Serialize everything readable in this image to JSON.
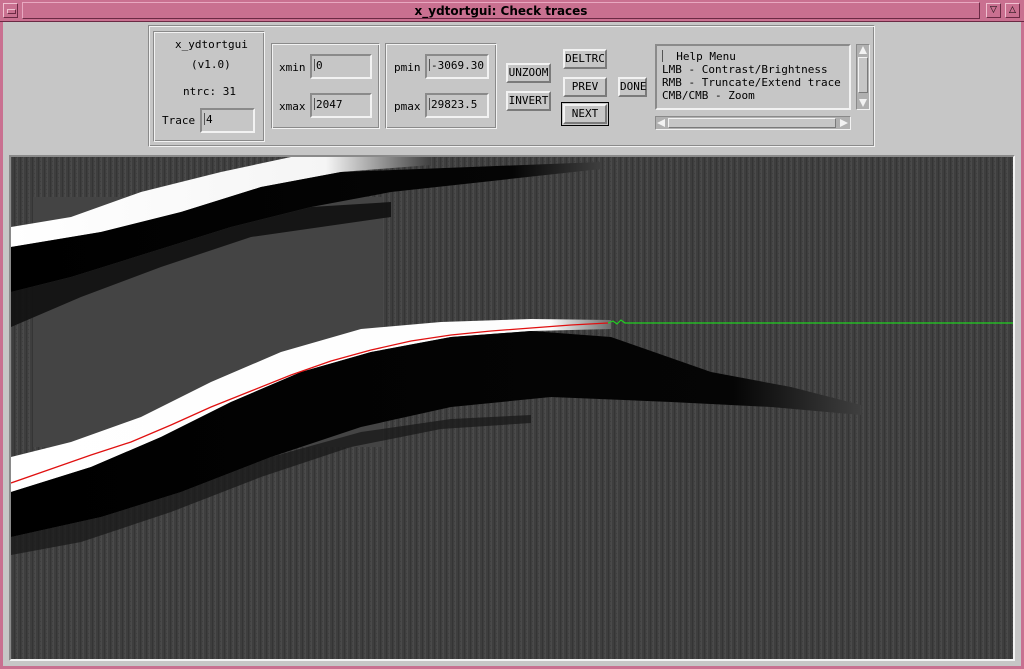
{
  "window": {
    "title": "x_ydtortgui: Check traces"
  },
  "info": {
    "app_name": "x_ydtortgui",
    "version": "(v1.0)",
    "ntrc_text": "ntrc: 31",
    "trace_label": "Trace",
    "trace_value": "4"
  },
  "xrange": {
    "xmin_label": "xmin",
    "xmin_value": "0",
    "xmax_label": "xmax",
    "xmax_value": "2047"
  },
  "prange": {
    "pmin_label": "pmin",
    "pmin_value": "-3069.30",
    "pmax_label": "pmax",
    "pmax_value": "29823.5"
  },
  "buttons": {
    "unzoom": "UNZOOM",
    "invert": "INVERT",
    "deltrc": "DELTRC",
    "prev": "PREV",
    "next": "NEXT",
    "done": "DONE"
  },
  "help": {
    "lines": [
      "Help Menu",
      "LMB - Contrast/Brightness",
      "RMB - Truncate/Extend trace",
      "CMB/CMB - Zoom"
    ]
  },
  "image_view": {
    "description_colors": {
      "background": "#3f3f3f",
      "trace_fit": "#e01010",
      "trace_extension": "#20d020"
    }
  }
}
